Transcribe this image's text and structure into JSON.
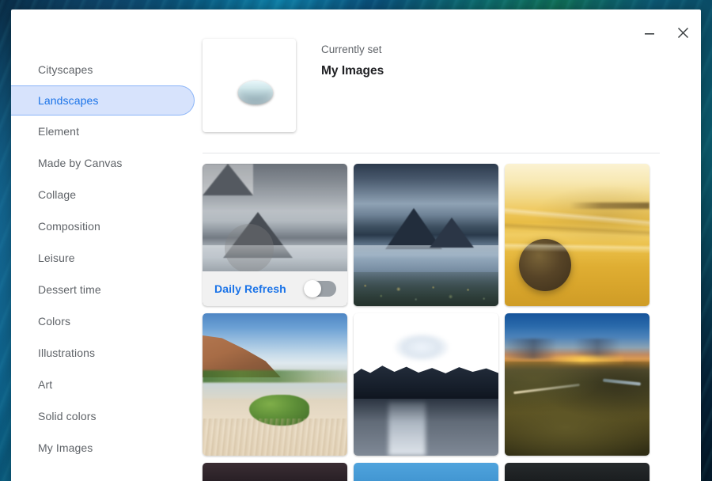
{
  "window": {
    "controls": {
      "minimize_name": "minimize",
      "close_name": "close"
    }
  },
  "sidebar": {
    "items": [
      {
        "label": "Cityscapes",
        "selected": false
      },
      {
        "label": "Landscapes",
        "selected": true
      },
      {
        "label": "Element",
        "selected": false
      },
      {
        "label": "Made by Canvas",
        "selected": false
      },
      {
        "label": "Collage",
        "selected": false
      },
      {
        "label": "Composition",
        "selected": false
      },
      {
        "label": "Leisure",
        "selected": false
      },
      {
        "label": "Dessert time",
        "selected": false
      },
      {
        "label": "Colors",
        "selected": false
      },
      {
        "label": "Illustrations",
        "selected": false
      },
      {
        "label": "Art",
        "selected": false
      },
      {
        "label": "Solid colors",
        "selected": false
      },
      {
        "label": "My Images",
        "selected": false
      }
    ]
  },
  "current": {
    "status_label": "Currently set",
    "name": "My Images",
    "thumbnail_alt": "peacock-feather-water-droplet"
  },
  "daily_refresh": {
    "label": "Daily Refresh",
    "enabled": false
  },
  "grid": {
    "tiles": [
      {
        "alt": "misty-mountain-lake-reflection",
        "kind": "daily-refresh-card"
      },
      {
        "alt": "storm-clouds-over-fjord-peaks",
        "kind": "wallpaper"
      },
      {
        "alt": "golden-sunset-beach-boulder",
        "kind": "wallpaper"
      },
      {
        "alt": "cliff-beach-green-seaweed-rock",
        "kind": "wallpaper"
      },
      {
        "alt": "moonlit-dark-lake-mountains",
        "kind": "wallpaper"
      },
      {
        "alt": "dusk-valley-winding-road",
        "kind": "wallpaper"
      },
      {
        "alt": "partial-tile-dark-brown",
        "kind": "wallpaper-partial"
      },
      {
        "alt": "partial-tile-blue",
        "kind": "wallpaper-partial"
      },
      {
        "alt": "partial-tile-dark",
        "kind": "wallpaper-partial"
      }
    ]
  },
  "colors": {
    "accent": "#1a73e8",
    "selected_pill_bg": "#d7e3fc",
    "selected_pill_border": "#8ab4f8",
    "sidebar_text": "#5f6368",
    "title_text": "#202124",
    "window_bg": "#ffffff",
    "divider": "#e4e6e8",
    "toggle_track_off": "#9aa0a6",
    "daily_bar_bg": "#f1f1f1"
  }
}
